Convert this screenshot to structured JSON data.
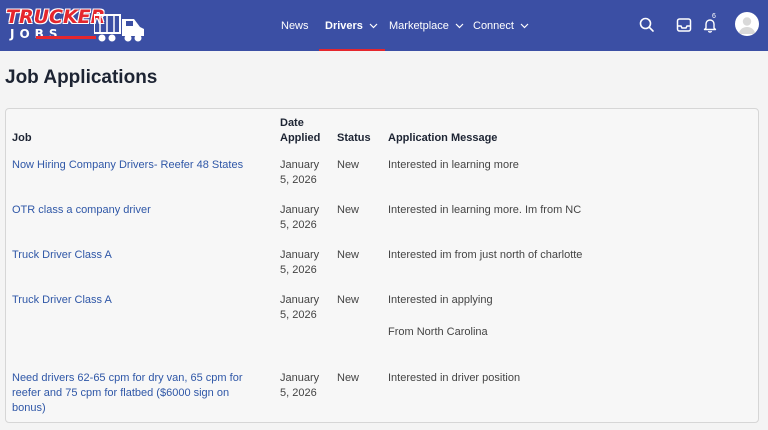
{
  "logo": {
    "word1": "TRUCKER",
    "word2": "JOBS"
  },
  "nav": {
    "items": [
      {
        "label": "News",
        "has_chevron": false
      },
      {
        "label": "Drivers",
        "has_chevron": true,
        "active": true
      },
      {
        "label": "Marketplace",
        "has_chevron": true
      },
      {
        "label": "Connect",
        "has_chevron": true
      }
    ],
    "icons": [
      "search-icon",
      "inbox-icon",
      "bell-icon",
      "avatar"
    ],
    "notification_count": "6"
  },
  "page": {
    "title": "Job Applications"
  },
  "table": {
    "headers": {
      "job": "Job",
      "date": "Date Applied",
      "status": "Status",
      "message": "Application Message"
    },
    "rows": [
      {
        "job": "Now Hiring Company Drivers- Reefer 48 States",
        "date": "January 5, 2026",
        "status": "New",
        "message": "Interested in learning more"
      },
      {
        "job": "OTR class a company driver",
        "date": "January 5, 2026",
        "status": "New",
        "message": "Interested in learning more. Im from NC"
      },
      {
        "job": "Truck Driver Class A",
        "date": "January 5, 2026",
        "status": "New",
        "message": "Interested im from just north of charlotte"
      },
      {
        "job": "Truck Driver Class A",
        "date": "January 5, 2026",
        "status": "New",
        "message": "Interested in applying",
        "message2": "From North Carolina"
      },
      {
        "job": "Need drivers 62-65 cpm for dry van, 65 cpm for reefer and 75 cpm for flatbed ($6000 sign on bonus)",
        "date": "January 5, 2026",
        "status": "New",
        "message": "Interested in driver position"
      }
    ]
  },
  "colors": {
    "header_bg": "#3b4fa4",
    "accent": "#e5262d",
    "link": "#2f57a7"
  }
}
